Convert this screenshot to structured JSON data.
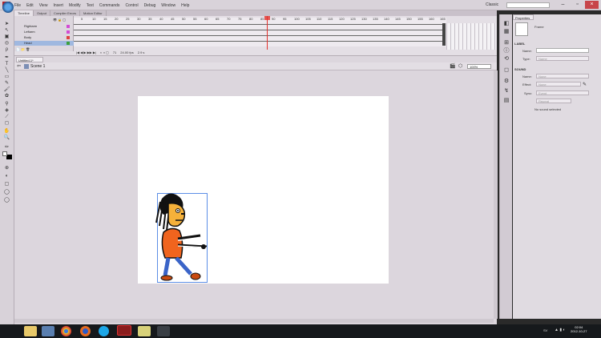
{
  "app": {
    "logo": "Fl"
  },
  "menu": [
    "File",
    "Edit",
    "View",
    "Insert",
    "Modify",
    "Text",
    "Commands",
    "Control",
    "Debug",
    "Window",
    "Help"
  ],
  "workspace": "Classic",
  "panel_tabs": [
    "Timeline",
    "Output",
    "Compiler Errors",
    "Motion Editor"
  ],
  "layers": [
    "Rightarm",
    "Leftarm",
    "Body",
    "Head"
  ],
  "ruler": [
    "5",
    "10",
    "15",
    "20",
    "25",
    "30",
    "35",
    "40",
    "45",
    "50",
    "55",
    "60",
    "65",
    "70",
    "75",
    "80",
    "85",
    "90",
    "95",
    "100",
    "105",
    "110",
    "115",
    "120",
    "125",
    "130",
    "135",
    "140",
    "145",
    "150",
    "155",
    "160",
    "165"
  ],
  "timeline_status": {
    "frame": "71",
    "fps": "24.00 fps",
    "time": "2.9 s"
  },
  "document": {
    "tab": "Untitled-1*",
    "scene": "Scene 1",
    "zoom": "100%"
  },
  "properties": {
    "tab": "Properties",
    "frame_label": "Frame",
    "label_section": "LABEL",
    "name_label": "Name:",
    "type_label": "Type:",
    "type_value": "Name",
    "sound_section": "SOUND",
    "sound_name_label": "Name:",
    "sound_name_value": "None",
    "effect_label": "Effect:",
    "effect_value": "None",
    "sync_label": "Sync:",
    "sync_value": "Event",
    "repeat_value": "Repeat",
    "no_sound": "No sound selected"
  },
  "taskbar": {
    "lang": "SV",
    "time": "02:04",
    "date": "2012-10-27"
  }
}
